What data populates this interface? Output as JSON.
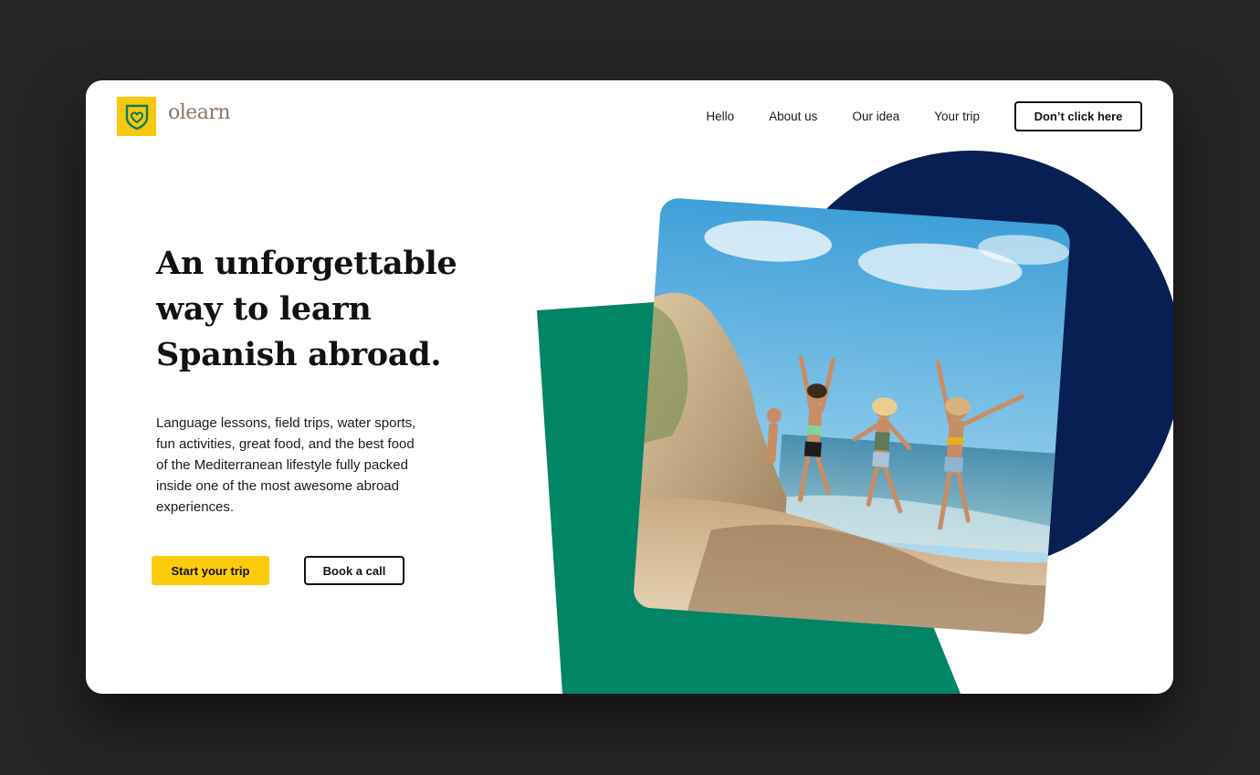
{
  "brand": {
    "name": "olearn",
    "logo_icon": "shield-heart-icon"
  },
  "nav": {
    "items": [
      {
        "label": "Hello"
      },
      {
        "label": "About us"
      },
      {
        "label": "Our idea"
      },
      {
        "label": "Your trip"
      }
    ],
    "cta_label": "Don’t click here"
  },
  "hero": {
    "headline_line1": "An unforgettable",
    "headline_line2": "way to learn",
    "headline_line3": "Spanish abroad.",
    "description": "Language lessons, field trips, water sports, fun activities, great food, and the best food of the Mediterranean lifestyle fully packed inside one of the most awesome abroad experiences.",
    "primary_cta": "Start your trip",
    "secondary_cta": "Book a call",
    "photo_subject": "friends-jumping-on-beach-photo"
  },
  "colors": {
    "brand_yellow": "#fccb0b",
    "logo_yellow": "#f6c90e",
    "logo_text": "#8a7668",
    "navy": "#071f52",
    "green": "#008565",
    "page_background": "#252525",
    "card_background": "#ffffff"
  }
}
